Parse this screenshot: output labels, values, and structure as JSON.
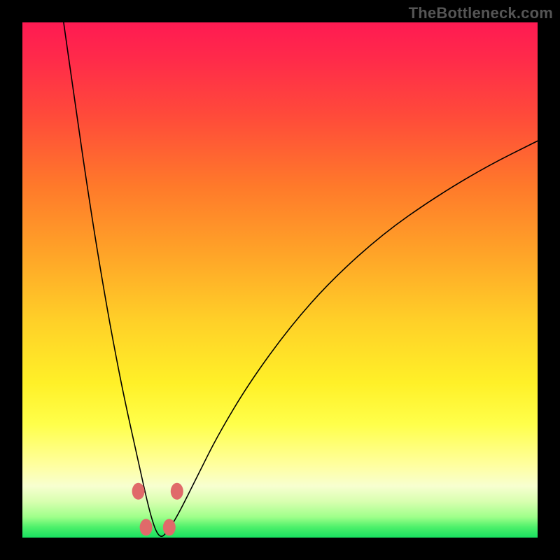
{
  "watermark": "TheBottleneck.com",
  "colors": {
    "frame": "#000000",
    "curve": "#000000",
    "marker": "#e06a6a",
    "gradient_top": "#ff1a52",
    "gradient_mid": "#ffd028",
    "gradient_bottom": "#18e060"
  },
  "chart_data": {
    "type": "line",
    "title": "",
    "xlabel": "",
    "ylabel": "",
    "xlim": [
      0,
      100
    ],
    "ylim": [
      0,
      100
    ],
    "grid": false,
    "legend": false,
    "annotations": [
      "TheBottleneck.com"
    ],
    "series": [
      {
        "name": "bottleneck-curve",
        "x": [
          8,
          10,
          12,
          14,
          16,
          18,
          20,
          22,
          24,
          25,
          26,
          27,
          28,
          30,
          34,
          38,
          44,
          52,
          60,
          70,
          80,
          90,
          100
        ],
        "values": [
          100,
          86,
          72,
          59,
          47,
          36,
          26,
          17,
          8,
          4,
          1,
          0,
          1,
          4,
          12,
          20,
          30,
          41,
          50,
          59,
          66,
          72,
          77
        ]
      }
    ],
    "markers": [
      {
        "x": 22.5,
        "y": 9
      },
      {
        "x": 30.0,
        "y": 9
      },
      {
        "x": 24.0,
        "y": 2
      },
      {
        "x": 28.5,
        "y": 2
      }
    ],
    "notes": "Single V-shaped curve on a vertical red→yellow→green gradient. No visible axes, ticks, or labels. Values are read off as percentages of plot width (x) and height (y=0 at bottom, y=100 at top), estimated from pixels."
  }
}
